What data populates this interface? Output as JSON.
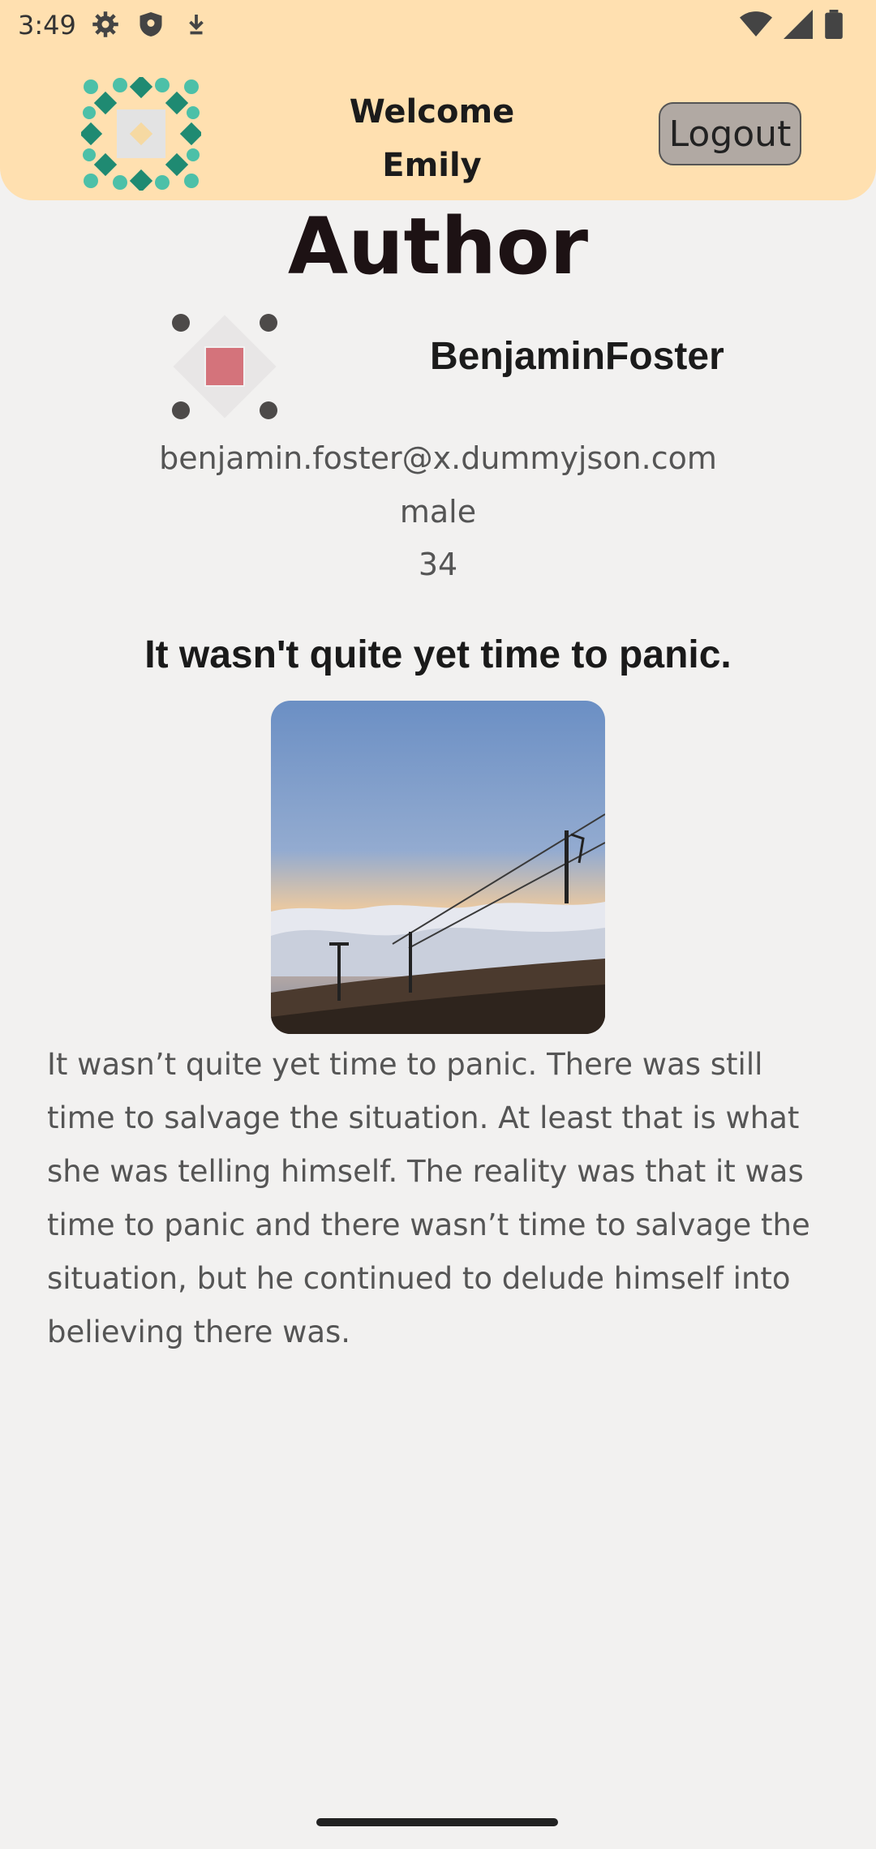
{
  "status_bar": {
    "time": "3:49",
    "left_icons": [
      "gear-icon",
      "shield-icon",
      "download-icon"
    ],
    "right_icons": [
      "wifi-icon",
      "signal-icon",
      "battery-icon"
    ]
  },
  "header": {
    "welcome_line1": "Welcome",
    "welcome_line2": "Emily",
    "logout_label": "Logout",
    "background_color": "#ffe0b0"
  },
  "page": {
    "title": "Author"
  },
  "author": {
    "name": "BenjaminFoster",
    "email": "benjamin.foster@x.dummyjson.com",
    "gender": "male",
    "age": "34"
  },
  "post": {
    "title": "It wasn't quite yet time to panic.",
    "body": "It wasn’t quite yet time to panic. There was still time to salvage the situation. At least that is what she was telling himself. The reality was that it was time to panic and there wasn’t time to salvage the situation, but he continued to delude himself into believing there was."
  }
}
